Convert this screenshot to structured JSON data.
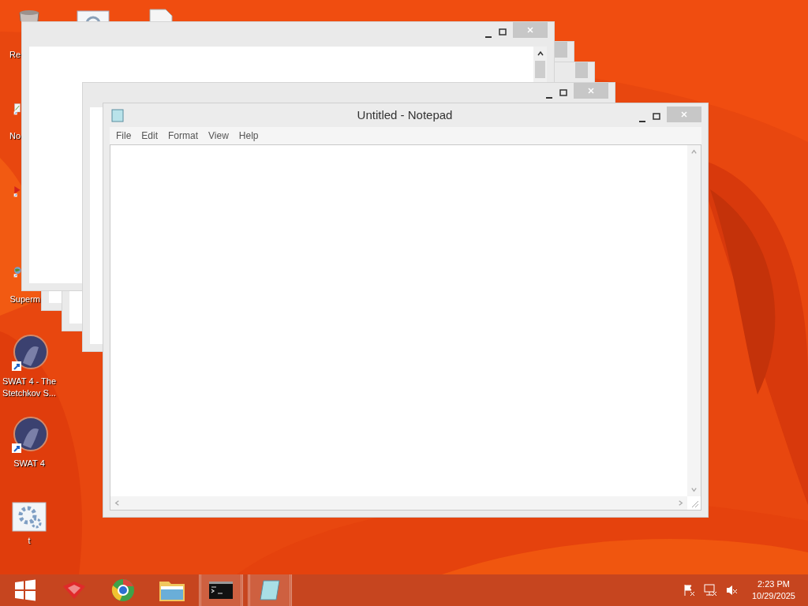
{
  "desktop_icons": [
    {
      "kind": "bin",
      "label": "Re"
    },
    {
      "kind": "doc"
    },
    {
      "kind": "page"
    },
    {
      "kind": "notepad",
      "label": "No"
    },
    {
      "kind": "media"
    },
    {
      "kind": "globe",
      "label": "Superm"
    },
    {
      "kind": "game",
      "label": "SWAT 4 - The Stetchkov S..."
    },
    {
      "kind": "game",
      "label": "SWAT 4"
    },
    {
      "kind": "gear",
      "label": "t"
    }
  ],
  "ghost_windows": [
    {
      "kind": "ghost"
    },
    {
      "kind": "ghost"
    },
    {
      "kind": "frame"
    },
    {
      "kind": "frame"
    }
  ],
  "notepad": {
    "title": "Untitled - Notepad",
    "menu": [
      "File",
      "Edit",
      "Format",
      "View",
      "Help"
    ]
  },
  "taskbar": {
    "items": [
      {
        "kind": "start",
        "running": false
      },
      {
        "kind": "app",
        "running": false
      },
      {
        "kind": "browser",
        "running": false
      },
      {
        "kind": "folder",
        "running": false
      },
      {
        "kind": "console",
        "running": true
      },
      {
        "kind": "notepad",
        "running": true
      }
    ],
    "tray": [
      {
        "kind": "flag"
      },
      {
        "kind": "network"
      },
      {
        "kind": "speaker"
      }
    ],
    "time": "2:23 PM",
    "date": "10/29/2025"
  }
}
